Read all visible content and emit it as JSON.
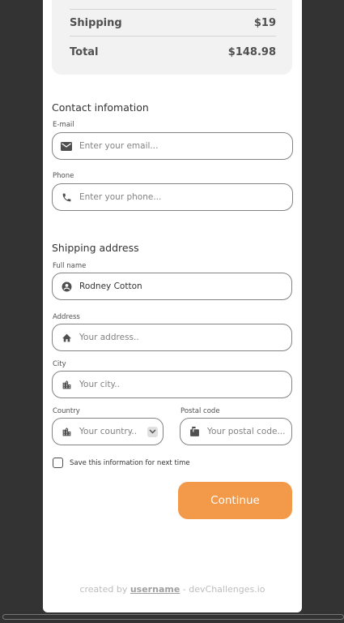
{
  "summary": {
    "shipping_label": "Shipping",
    "shipping_value": "$19",
    "total_label": "Total",
    "total_value": "$148.98"
  },
  "contact": {
    "title": "Contact infomation",
    "email_label": "E-mail",
    "email_placeholder": "Enter your email...",
    "phone_label": "Phone",
    "phone_placeholder": "Enter your phone..."
  },
  "shipping": {
    "title": "Shipping address",
    "fullname_label": "Full name",
    "fullname_value": "Rodney Cotton",
    "address_label": "Address",
    "address_placeholder": "Your address..",
    "city_label": "City",
    "city_placeholder": "Your city..",
    "country_label": "Country",
    "country_placeholder": "Your country..",
    "postal_label": "Postal code",
    "postal_placeholder": "Your postal code..."
  },
  "save_info_label": "Save this information for next time",
  "continue_label": "Continue",
  "footer": {
    "prefix": "created by",
    "username": "username",
    "suffix": "- devChallenges.io"
  },
  "colors": {
    "accent": "#F2994A",
    "background": "#333333"
  }
}
